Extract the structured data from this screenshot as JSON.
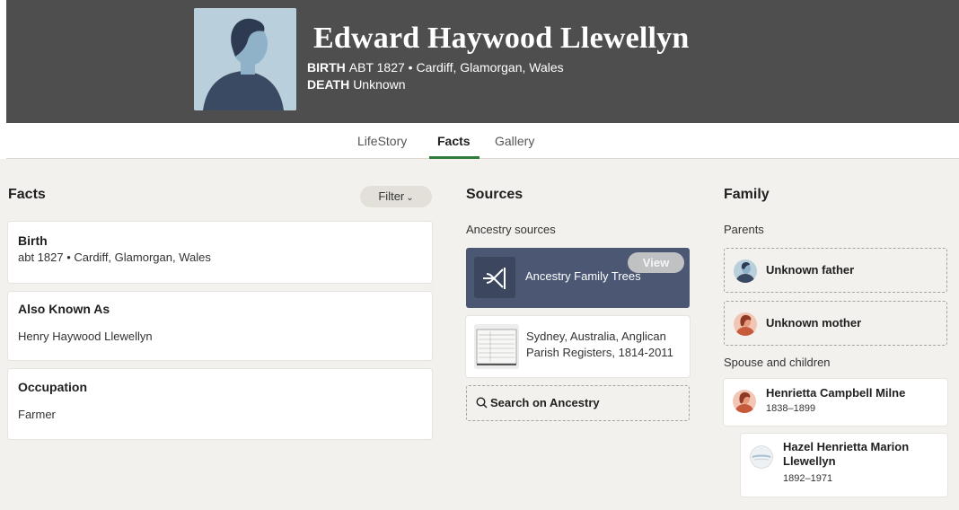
{
  "person": {
    "name": "Edward Haywood Llewellyn",
    "birth_label": "BIRTH",
    "birth_value": "ABT 1827 • Cardiff, Glamorgan, Wales",
    "death_label": "DEATH",
    "death_value": "Unknown"
  },
  "tabs": [
    {
      "label": "LifeStory"
    },
    {
      "label": "Facts"
    },
    {
      "label": "Gallery"
    }
  ],
  "facts": {
    "title": "Facts",
    "filter_label": "Filter",
    "items": [
      {
        "title": "Birth",
        "value": "abt 1827 • Cardiff, Glamorgan, Wales"
      },
      {
        "title": "Also Known As",
        "value": "Henry Haywood Llewellyn"
      },
      {
        "title": "Occupation",
        "value": "Farmer"
      }
    ]
  },
  "sources": {
    "title": "Sources",
    "subtitle": "Ancestry sources",
    "tree_label": "Ancestry Family Trees",
    "view_label": "View",
    "record_label": "Sydney, Australia, Anglican Parish Registers, 1814-2011",
    "search_label": "Search on Ancestry"
  },
  "family": {
    "title": "Family",
    "parents_label": "Parents",
    "father": "Unknown father",
    "mother": "Unknown mother",
    "spouse_label": "Spouse and children",
    "spouse": {
      "name": "Henrietta Campbell Milne",
      "years": "1838–1899"
    },
    "child": {
      "name": "Hazel Henrietta Marion Llewellyn",
      "years": "1892–1971"
    }
  },
  "colors": {
    "header_bg": "#4e4e4e",
    "accent_green": "#2f7a3d",
    "tree_card_bg": "#4b5773",
    "page_bg": "#f3f1ed"
  }
}
